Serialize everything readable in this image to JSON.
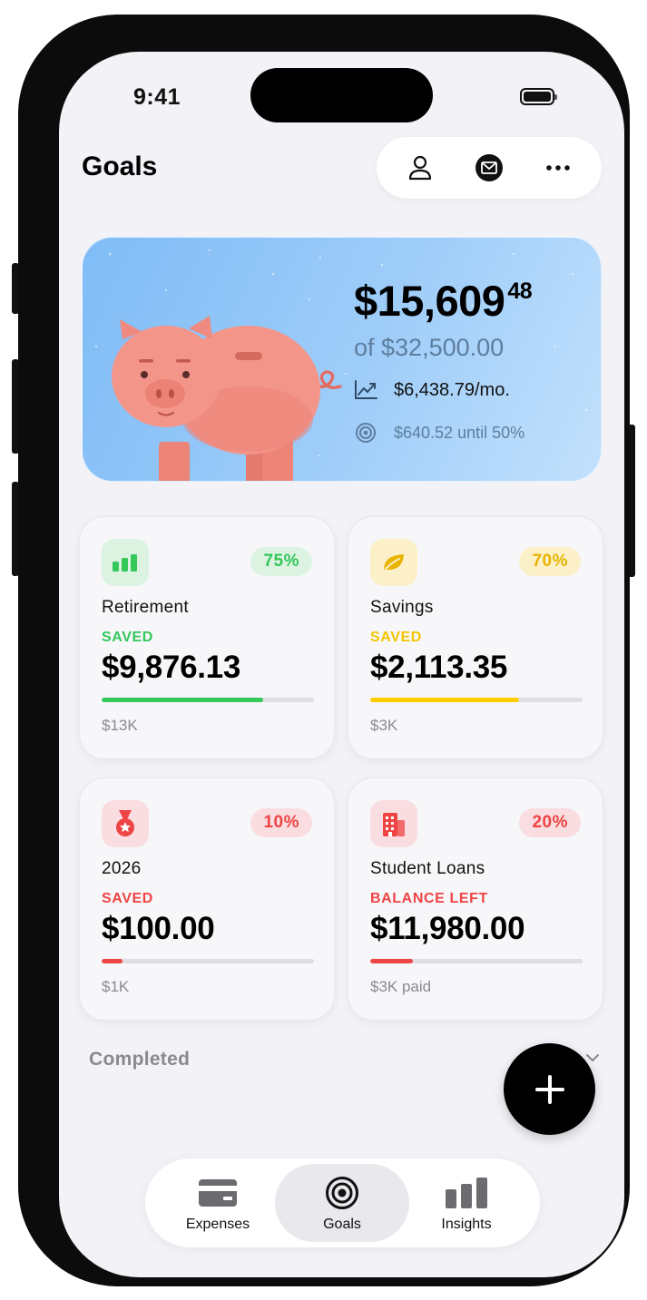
{
  "status_bar": {
    "time": "9:41"
  },
  "header": {
    "title": "Goals",
    "actions": [
      "person-icon",
      "mail-icon",
      "more-icon"
    ]
  },
  "hero": {
    "amount_main": "$15,609",
    "amount_cents": "48",
    "target": "of $32,500.00",
    "monthly": "$6,438.79/mo.",
    "milestone": "$640.52 until 50%",
    "progress_fraction": 0.48
  },
  "goals": [
    {
      "name": "Retirement",
      "percent_label": "75%",
      "status": "SAVED",
      "amount": "$9,876.13",
      "target": "$13K",
      "progress": 0.76,
      "icon": "bar-chart-icon",
      "color": "#34c759",
      "tint": "#dcf3e2"
    },
    {
      "name": "Savings",
      "percent_label": "70%",
      "status": "SAVED",
      "amount": "$2,113.35",
      "target": "$3K",
      "progress": 0.7,
      "icon": "leaf-icon",
      "color": "#ffcc00",
      "tint": "#fbf0c8"
    },
    {
      "name": "2026",
      "percent_label": "10%",
      "status": "SAVED",
      "amount": "$100.00",
      "target": "$1K",
      "progress": 0.1,
      "icon": "medal-icon",
      "color": "#ef4444",
      "tint": "#f9dde0"
    },
    {
      "name": "Student Loans",
      "percent_label": "20%",
      "status": "BALANCE LEFT",
      "amount": "$11,980.00",
      "target": "$3K paid",
      "progress": 0.2,
      "icon": "building-icon",
      "color": "#ef4444",
      "tint": "#f9dde0"
    }
  ],
  "completed": {
    "label": "Completed"
  },
  "tabs": [
    {
      "label": "Expenses",
      "icon": "card-icon",
      "active": false
    },
    {
      "label": "Goals",
      "icon": "target-icon",
      "active": true
    },
    {
      "label": "Insights",
      "icon": "chart-icon",
      "active": false
    }
  ]
}
